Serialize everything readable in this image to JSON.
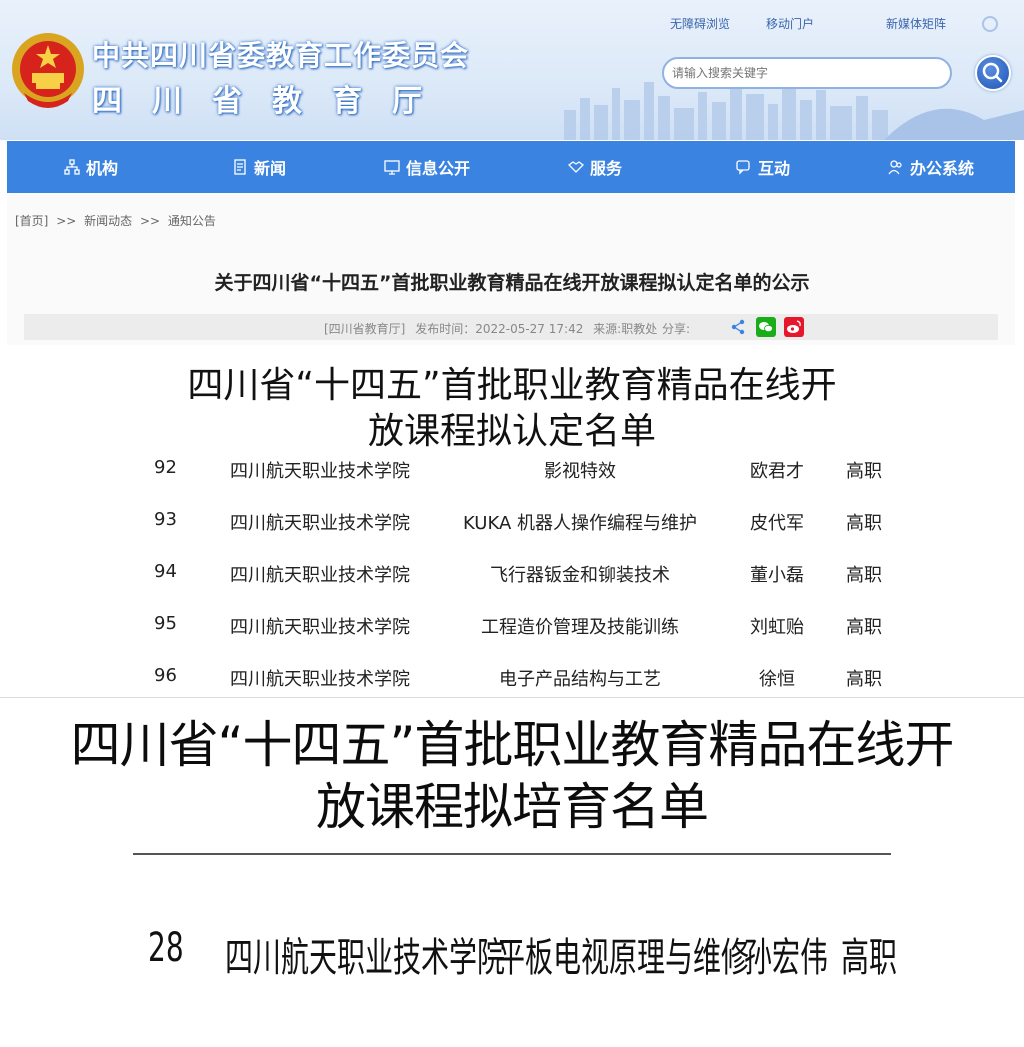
{
  "header": {
    "site_name_line1": "中共四川省委教育工作委员会",
    "site_name_line2": "四川省教育厅",
    "top_links": [
      "无障碍浏览",
      "移动门户",
      "新媒体矩阵"
    ],
    "search_placeholder": "请输入搜索关键字"
  },
  "nav": {
    "items": [
      {
        "label": "机构",
        "icon": "org-chart-icon"
      },
      {
        "label": "新闻",
        "icon": "document-icon"
      },
      {
        "label": "信息公开",
        "icon": "monitor-icon"
      },
      {
        "label": "服务",
        "icon": "handshake-icon"
      },
      {
        "label": "互动",
        "icon": "chat-icon"
      },
      {
        "label": "办公系统",
        "icon": "user-group-icon"
      }
    ]
  },
  "breadcrumb": {
    "home": "[首页]",
    "sep": ">>",
    "level1": "新闻动态",
    "level2": "通知公告"
  },
  "article": {
    "title": "关于四川省“十四五”首批职业教育精品在线开放课程拟认定名单的公示",
    "source": "[四川省教育厅]",
    "publish_time": "发布时间：2022-05-27 17:42",
    "origin": "来源:职教处",
    "share_label": "分享:"
  },
  "image1": {
    "title_line1": "四川省“十四五”首批职业教育精品在线开",
    "title_line2": "放课程拟认定名单",
    "rows": [
      {
        "num": "92",
        "school": "四川航天职业技术学院",
        "course": "影视特效",
        "person": "欧君才",
        "level": "高职"
      },
      {
        "num": "93",
        "school": "四川航天职业技术学院",
        "course": "KUKA 机器人操作编程与维护",
        "person": "皮代军",
        "level": "高职"
      },
      {
        "num": "94",
        "school": "四川航天职业技术学院",
        "course": "飞行器钣金和铆装技术",
        "person": "董小磊",
        "level": "高职"
      },
      {
        "num": "95",
        "school": "四川航天职业技术学院",
        "course": "工程造价管理及技能训练",
        "person": "刘虹贻",
        "level": "高职"
      },
      {
        "num": "96",
        "school": "四川航天职业技术学院",
        "course": "电子产品结构与工艺",
        "person": "徐恒",
        "level": "高职"
      }
    ]
  },
  "image2": {
    "title_line1": "四川省“十四五”首批职业教育精品在线开",
    "title_line2": "放课程拟培育名单"
  },
  "image3": {
    "row": {
      "num": "28",
      "school": "四川航天职业技术学院",
      "course": "平板电视原理与维修",
      "person": "孙宏伟",
      "level": "高职"
    }
  },
  "colors": {
    "nav_bg": "#3a83e0",
    "header_bg": "#dce9f8",
    "wechat": "#1aad19",
    "weibo": "#e6162d"
  }
}
